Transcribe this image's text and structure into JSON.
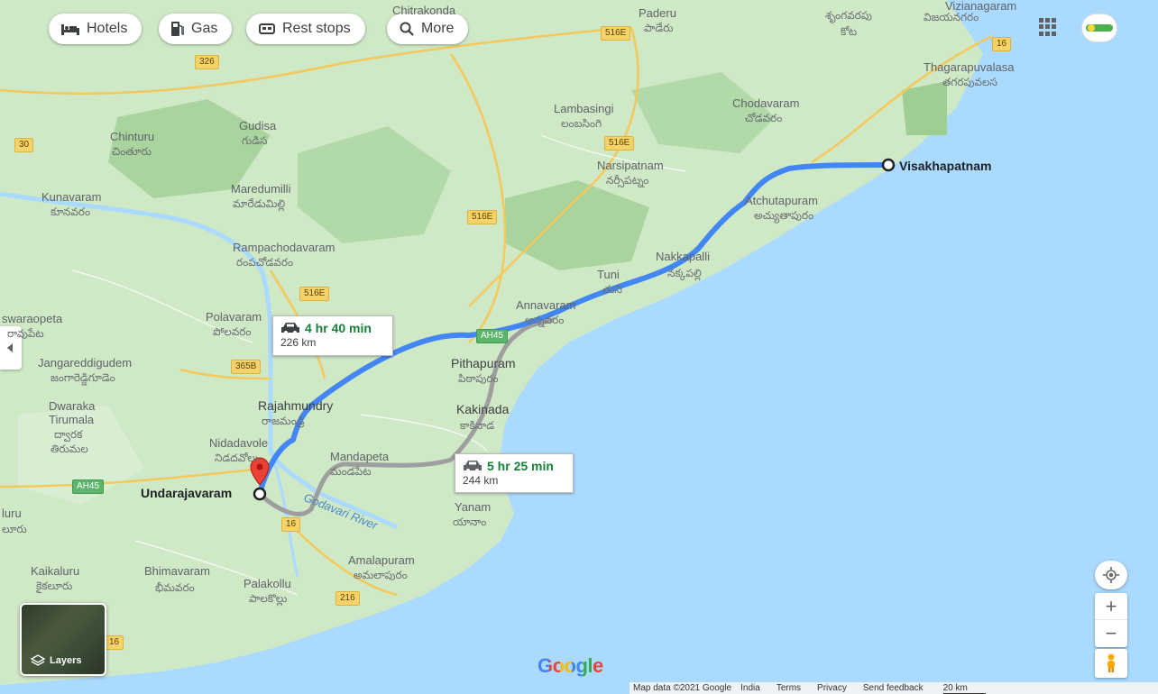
{
  "toolbar": {
    "hotels": "Hotels",
    "gas": "Gas",
    "rest_stops": "Rest stops",
    "more": "More"
  },
  "routes": {
    "primary": {
      "duration": "4 hr 40 min",
      "distance": "226 km",
      "color": "#4285f4"
    },
    "alternate": {
      "duration": "5 hr 25 min",
      "distance": "244 km",
      "color": "#9e9e9e"
    }
  },
  "places": {
    "origin": "Undarajavaram",
    "destination": "Visakhapatnam",
    "paderu": "Paderu",
    "paderu_te": "పాడేరు",
    "chitrakonda": "Chitrakonda",
    "srungavarapu_te": "శృంగవరపు",
    "kota_te": "కోట",
    "vizianagaram_te": "విజయనగరం",
    "thagarapuvalasa": "Thagarapuvalasa",
    "thagarapuvalasa_te": "తగరపువలస",
    "vizianagaram_top": "Vizianagaram",
    "lambasingi": "Lambasingi",
    "lambasingi_te": "లంబసింగి",
    "chodavaram": "Chodavaram",
    "chodavaram_te": "చోడవరం",
    "chinturu": "Chinturu",
    "chinturu_te": "చింతూరు",
    "gudisa": "Gudisa",
    "gudisa_te": "గుడిస",
    "narsipatnam": "Narsipatnam",
    "narsipatnam_te": "నర్సీపట్నం",
    "kunavaram": "Kunavaram",
    "kunavaram_te": "కూనవరం",
    "maredumilli": "Maredumilli",
    "maredumilli_te": "మారేడుమిల్లి",
    "atchutapuram": "Atchutapuram",
    "atchutapuram_te": "అచ్యుతాపురం",
    "rampachodavaram": "Rampachodavaram",
    "rampachodavaram_te": "రంపచోడవరం",
    "nakkapalli": "Nakkapalli",
    "nakkapalli_te": "నక్కపల్లి",
    "tuni": "Tuni",
    "tuni_te": "తుని",
    "annavaram": "Annavaram",
    "annavaram_te": "అన్నవరం",
    "aswaraopeta": "swaraopeta",
    "aswaraopeta_te": "రావుపేట",
    "polavaram": "Polavaram",
    "polavaram_te": "పోలవరం",
    "jangareddigudem": "Jangareddigudem",
    "jangareddigudem_te": "జంగారెడ్డిగూడెం",
    "pithapuram": "Pithapuram",
    "pithapuram_te": "పిఠాపురం",
    "rajahmundry": "Rajahmundry",
    "rajahmundry_te": "రాజమండ్రి",
    "dwaraka_tirumala": "Dwaraka",
    "dwaraka_tirumala2": "Tirumala",
    "dwaraka_te": "ద్వారక",
    "tirumala_te": "తిరుమల",
    "kakinada": "Kakinada",
    "kakinada_te": "కాకినాడ",
    "nidadavole": "Nidadavole",
    "nidadavole_te": "నిడదవోలు",
    "mandapeta": "Mandapeta",
    "mandapeta_te": "మండపేట",
    "godavari_river": "Godavari River",
    "yanam": "Yanam",
    "yanam_te": "యానాం",
    "eluru": "luru",
    "eluru_te": "లూరు",
    "kaikaluru": "Kaikaluru",
    "kaikaluru_te": "కైకలూరు",
    "bhimavaram": "Bhimavaram",
    "bhimavaram_te": "భీమవరం",
    "palakollu": "Palakollu",
    "palakollu_te": "పాలకొల్లు",
    "amalapuram": "Amalapuram",
    "amalapuram_te": "అమలాపురం"
  },
  "shields": {
    "r326": "326",
    "r516e_a": "516E",
    "r516e_b": "516E",
    "r516e_c": "516E",
    "r516e_d": "516E",
    "r16_a": "16",
    "r16_b": "16",
    "r16_c": "16",
    "r30": "30",
    "r365b": "365B",
    "ah45_a": "AH45",
    "ah45_b": "AH45",
    "r216": "216"
  },
  "controls": {
    "layers": "Layers",
    "zoom_in": "+",
    "zoom_out": "−",
    "google": "Google"
  },
  "footer": {
    "map_data": "Map data ©2021 Google",
    "india": "India",
    "terms": "Terms",
    "privacy": "Privacy",
    "feedback": "Send feedback",
    "scale": "20 km"
  },
  "colors": {
    "land": "#c6e5c0",
    "sea": "#aadaff",
    "forest": "#a8d49d",
    "road": "#f5c85a"
  }
}
